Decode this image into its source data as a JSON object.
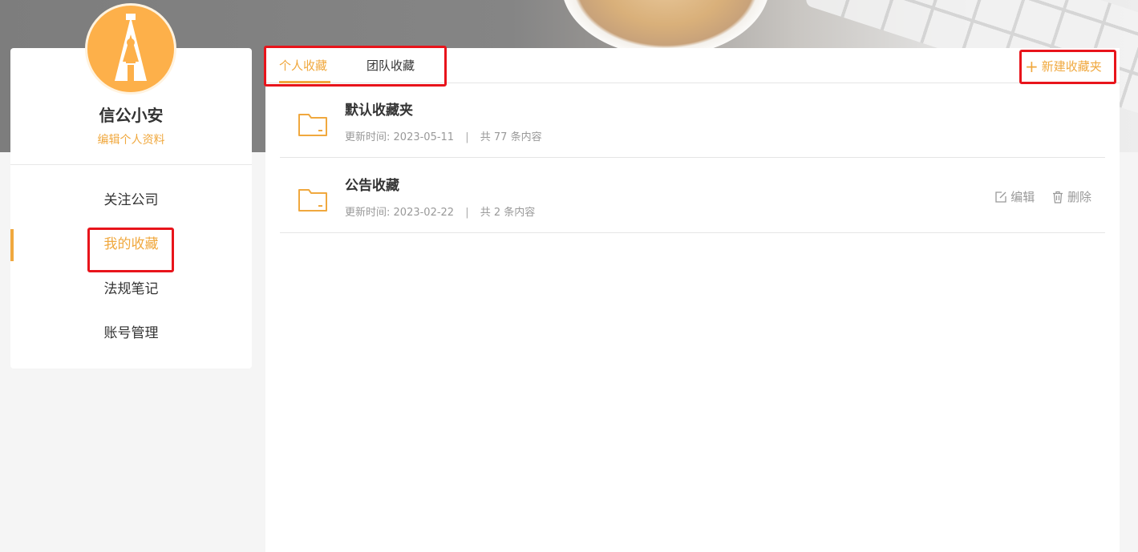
{
  "profile": {
    "name": "信公小安",
    "edit_label": "编辑个人资料"
  },
  "sidebar": {
    "items": [
      {
        "label": "关注公司"
      },
      {
        "label": "我的收藏",
        "active": true
      },
      {
        "label": "法规笔记"
      },
      {
        "label": "账号管理"
      }
    ]
  },
  "tabs": [
    {
      "label": "个人收藏",
      "active": true
    },
    {
      "label": "团队收藏"
    }
  ],
  "new_folder_label": "新建收藏夹",
  "folders": [
    {
      "title": "默认收藏夹",
      "updated_label": "更新时间:",
      "updated_date": "2023-05-11",
      "count_label": "共 77 条内容"
    },
    {
      "title": "公告收藏",
      "updated_label": "更新时间:",
      "updated_date": "2023-02-22",
      "count_label": "共 2 条内容",
      "actions": {
        "edit": "编辑",
        "delete": "删除"
      }
    }
  ],
  "colors": {
    "accent": "#f0a83e",
    "highlight": "#e8141b",
    "avatar_bg": "#fdb04a"
  },
  "icons": [
    "folder-icon",
    "edit-icon",
    "trash-icon",
    "plus-icon"
  ]
}
